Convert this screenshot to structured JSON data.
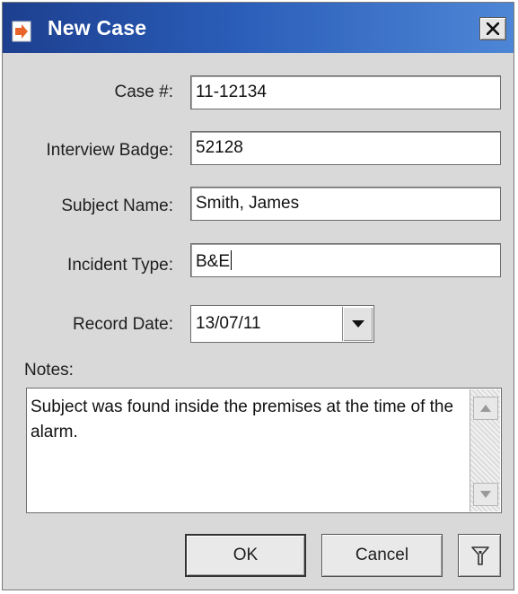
{
  "window": {
    "title": "New Case"
  },
  "form": {
    "case_number_label": "Case #:",
    "case_number_value": "11-12134",
    "interview_badge_label": "Interview Badge:",
    "interview_badge_value": "52128",
    "subject_name_label": "Subject Name:",
    "subject_name_value": "Smith, James",
    "incident_type_label": "Incident Type:",
    "incident_type_value": "B&E",
    "record_date_label": "Record Date:",
    "record_date_value": "13/07/11",
    "notes_label": "Notes:",
    "notes_value": "Subject was found inside the premises at the time of the alarm."
  },
  "buttons": {
    "ok_label": "OK",
    "cancel_label": "Cancel"
  },
  "icons": {
    "title": "form-document-icon",
    "close": "close-icon",
    "dropdown": "chevron-down-icon",
    "scroll_up": "scroll-up-arrow-icon",
    "scroll_down": "scroll-down-arrow-icon",
    "info": "info-icon"
  },
  "colors": {
    "titlebar_start": "#1d3f8f",
    "titlebar_end": "#4e86d6",
    "dialog_bg": "#d9d9d9",
    "icon_accent": "#e8642a"
  }
}
